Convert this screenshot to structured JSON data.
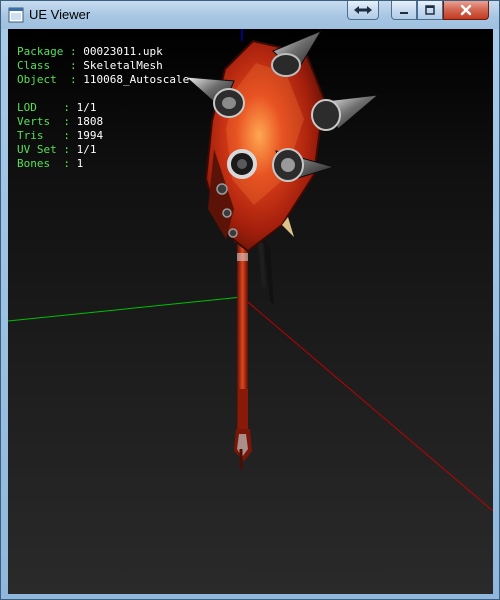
{
  "window": {
    "title": "UE Viewer",
    "icons": {
      "app": "viewer-app-icon",
      "restore": "restore-arrows-icon",
      "minimize": "minimize-icon",
      "maximize": "maximize-icon",
      "close": "close-icon"
    }
  },
  "info": {
    "package": {
      "label": "Package",
      "value": "00023011.upk"
    },
    "class": {
      "label": "Class",
      "value": "SkeletalMesh"
    },
    "object": {
      "label": "Object",
      "value": "110068_Autoscale"
    },
    "lod": {
      "label": "LOD",
      "value": "1/1"
    },
    "verts": {
      "label": "Verts",
      "value": "1808"
    },
    "tris": {
      "label": "Tris",
      "value": "1994"
    },
    "uvset": {
      "label": "UV Set",
      "value": "1/1"
    },
    "bones": {
      "label": "Bones",
      "value": "1"
    }
  },
  "colors": {
    "info_label": "#55e055",
    "info_value": "#ffffff",
    "axis_x": "#c00000",
    "axis_y": "#00c000",
    "axis_z": "#0000ff"
  }
}
